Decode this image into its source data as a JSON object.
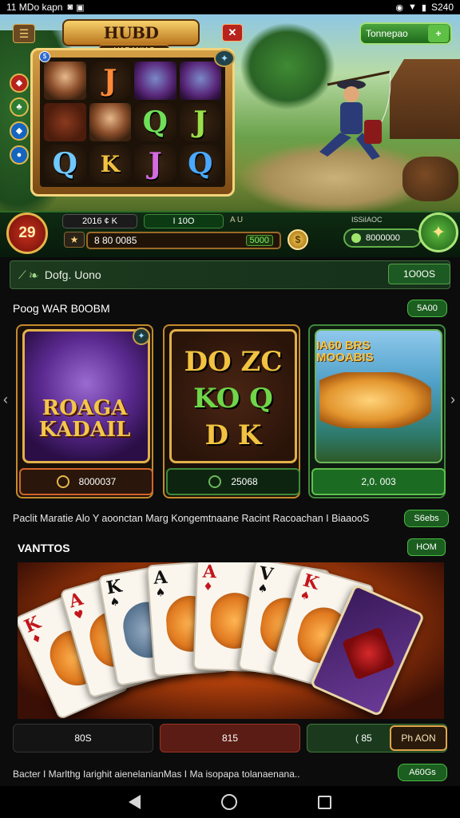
{
  "status_bar": {
    "left_text": "11 MDo kapn",
    "time": "S240"
  },
  "hero": {
    "logo": "HUBD DIDENSIA",
    "sub_logo": "UADANIAS",
    "top_pill": "Tonnepao",
    "slot_symbols": [
      "",
      "J",
      "",
      "",
      "",
      "",
      "Q",
      "J",
      "Q",
      "",
      "J",
      "Q"
    ]
  },
  "infobar": {
    "level": "29",
    "pill_a": "2016 ¢ K",
    "pill_b": "I 10O",
    "pill_c": "A U",
    "balance": "8 80 0085",
    "balance_green": "5000",
    "right_label": "ISSiIAOC",
    "right_pill": "8000000"
  },
  "notice": {
    "text": "Dofg. Uono",
    "button": "1O0OS"
  },
  "section1": {
    "title": "Poog WAR B0OBM",
    "pill": "5A00"
  },
  "cards": [
    {
      "title": "ROAGA KADAIL",
      "footer": "8000037"
    },
    {
      "lines": [
        "DO ZC",
        "KO Q",
        "D K"
      ],
      "footer": "25068"
    },
    {
      "title": "IA60 BRS MOOABIS",
      "footer": "2,0. 003"
    }
  ],
  "ticker": {
    "text": "Paclit Maratie Alo Y aoonctan Marg Kongemtnaane Racint Racoachan I BiaaooS",
    "button": "S6ebs"
  },
  "section2": {
    "title": "VANTTOS",
    "button": "HOM"
  },
  "bottom_buttons": {
    "b1": "80S",
    "b2": "815",
    "b3": "( 85",
    "play": "Ph AON"
  },
  "footer": {
    "text": "Bacter I Marlthg Iarighit aienelanianMas I Ma isopapa tolanaenana..",
    "button": "A60Gs"
  },
  "colors": {
    "accent_green": "#1b5e20",
    "gold": "#e1b049",
    "dark_bg": "#0c0c0c"
  }
}
